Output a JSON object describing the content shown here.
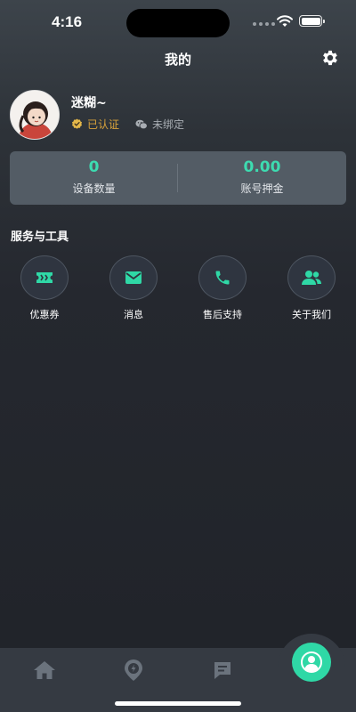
{
  "status_bar": {
    "time": "4:16"
  },
  "header": {
    "title": "我的"
  },
  "profile": {
    "username": "迷糊~",
    "verified_label": "已认证",
    "wechat_label": "未绑定"
  },
  "stats": [
    {
      "value": "0",
      "label": "设备数量"
    },
    {
      "value": "0.00",
      "label": "账号押金"
    }
  ],
  "services": {
    "title": "服务与工具",
    "items": [
      {
        "label": "优惠券",
        "icon": "ticket-icon"
      },
      {
        "label": "消息",
        "icon": "mail-icon"
      },
      {
        "label": "售后支持",
        "icon": "phone-icon"
      },
      {
        "label": "关于我们",
        "icon": "users-icon"
      }
    ]
  },
  "tabbar": {
    "items": [
      {
        "icon": "home-icon"
      },
      {
        "icon": "location-icon"
      },
      {
        "icon": "orders-icon"
      },
      {
        "icon": "profile-icon",
        "active": true
      }
    ]
  },
  "colors": {
    "accent": "#2fd8a6",
    "number": "#3ddbb0",
    "verified": "#d9a23a"
  }
}
